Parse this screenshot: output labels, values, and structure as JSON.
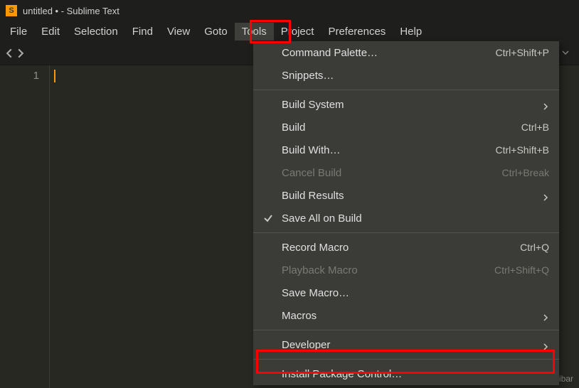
{
  "title": "untitled • - Sublime Text",
  "menubar": [
    "File",
    "Edit",
    "Selection",
    "Find",
    "View",
    "Goto",
    "Tools",
    "Project",
    "Preferences",
    "Help"
  ],
  "active_menu_index": 6,
  "gutter_line": "1",
  "watermark": "CSDN @Xiaoyibar",
  "dropdown": {
    "command_palette": {
      "label": "Command Palette…",
      "shortcut": "Ctrl+Shift+P"
    },
    "snippets": {
      "label": "Snippets…"
    },
    "build_system": {
      "label": "Build System"
    },
    "build": {
      "label": "Build",
      "shortcut": "Ctrl+B"
    },
    "build_with": {
      "label": "Build With…",
      "shortcut": "Ctrl+Shift+B"
    },
    "cancel_build": {
      "label": "Cancel Build",
      "shortcut": "Ctrl+Break"
    },
    "build_results": {
      "label": "Build Results"
    },
    "save_all_on_build": {
      "label": "Save All on Build"
    },
    "record_macro": {
      "label": "Record Macro",
      "shortcut": "Ctrl+Q"
    },
    "playback_macro": {
      "label": "Playback Macro",
      "shortcut": "Ctrl+Shift+Q"
    },
    "save_macro": {
      "label": "Save Macro…"
    },
    "macros": {
      "label": "Macros"
    },
    "developer": {
      "label": "Developer"
    },
    "install_package_control": {
      "label": "Install Package Control…"
    }
  }
}
